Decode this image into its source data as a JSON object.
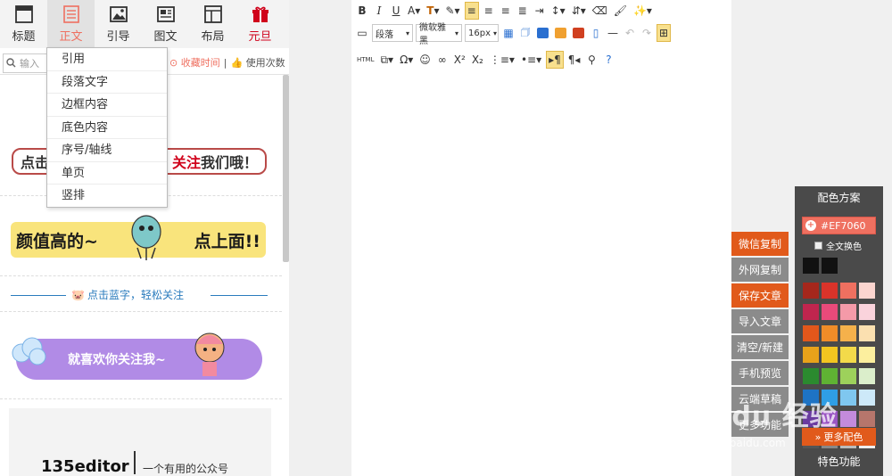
{
  "categories": [
    {
      "label": "标题",
      "icon": "title-icon"
    },
    {
      "label": "正文",
      "icon": "text-icon",
      "active": true
    },
    {
      "label": "引导",
      "icon": "image-guide-icon"
    },
    {
      "label": "图文",
      "icon": "image-text-icon"
    },
    {
      "label": "布局",
      "icon": "layout-icon"
    },
    {
      "label": "元旦",
      "icon": "gift-icon"
    }
  ],
  "search": {
    "placeholder": "输入"
  },
  "sort": {
    "favorites": "收藏时间",
    "divider": "|",
    "usage": "使用次数"
  },
  "dropdown": [
    "引用",
    "段落文字",
    "边框内容",
    "底色内容",
    "序号/轴线",
    "单页",
    "竖排"
  ],
  "templates": {
    "bubble_left": "点击",
    "bubble_red": "关注",
    "bubble_right": "我们哦！",
    "yellow_left": "颜值高的~",
    "yellow_right": "点上面!!",
    "line_text": "点击蓝字，轻松关注",
    "purple_text": "就喜欢你关注我~"
  },
  "profile": {
    "name": "135editor",
    "separator": "|",
    "tagline": "一个有用的公众号"
  },
  "toolbar": {
    "row1": [
      "B",
      "I",
      "U",
      "A",
      "T",
      "✎"
    ],
    "paragraph": "段落",
    "font": "微软雅黑",
    "size": "16px",
    "html": "HTML",
    "omega": "Ω",
    "sup": "X²",
    "sub": "X₂"
  },
  "actions": [
    {
      "label": "微信复制",
      "style": "orange"
    },
    {
      "label": "外网复制",
      "style": "grey"
    },
    {
      "label": "保存文章",
      "style": "orange"
    },
    {
      "label": "导入文章",
      "style": "grey"
    },
    {
      "label": "清空/新建",
      "style": "grey"
    },
    {
      "label": "手机预览",
      "style": "grey"
    },
    {
      "label": "云端草稿",
      "style": "grey"
    },
    {
      "label": "更多功能",
      "style": "grey"
    }
  ],
  "colorpanel": {
    "title": "配色方案",
    "hex": "#EF7060",
    "all_label": "全文换色",
    "more_label": "更多配色",
    "special_label": "特色功能",
    "blacks": [
      "#111111",
      "#111111"
    ],
    "swatches": [
      "#a5271c",
      "#d9332a",
      "#ef7060",
      "#fbd5cf",
      "#c0254e",
      "#e94a7a",
      "#f49aa8",
      "#fad3dc",
      "#e2571b",
      "#f08c28",
      "#f5b14b",
      "#fbe0b0",
      "#e8a21a",
      "#f2c520",
      "#f3da4a",
      "#fcef9e",
      "#2b8a2f",
      "#5fb233",
      "#9dd15b",
      "#dbeecb",
      "#1e73c4",
      "#2f9ee5",
      "#7fc7ef",
      "#cde9f9",
      "#6a3ba0",
      "#9a55c3",
      "#c38bdc",
      "#b6766c",
      "#555555",
      "#888888",
      "#bbbbbb",
      "#eeeeee"
    ]
  },
  "watermark": {
    "brand": "Baidu 经验",
    "url": "jingyan.baidu.com"
  },
  "colors": {
    "accent": "#ef7060",
    "action_orange": "#e15a1b",
    "panel_bg": "#4a4a4a"
  }
}
